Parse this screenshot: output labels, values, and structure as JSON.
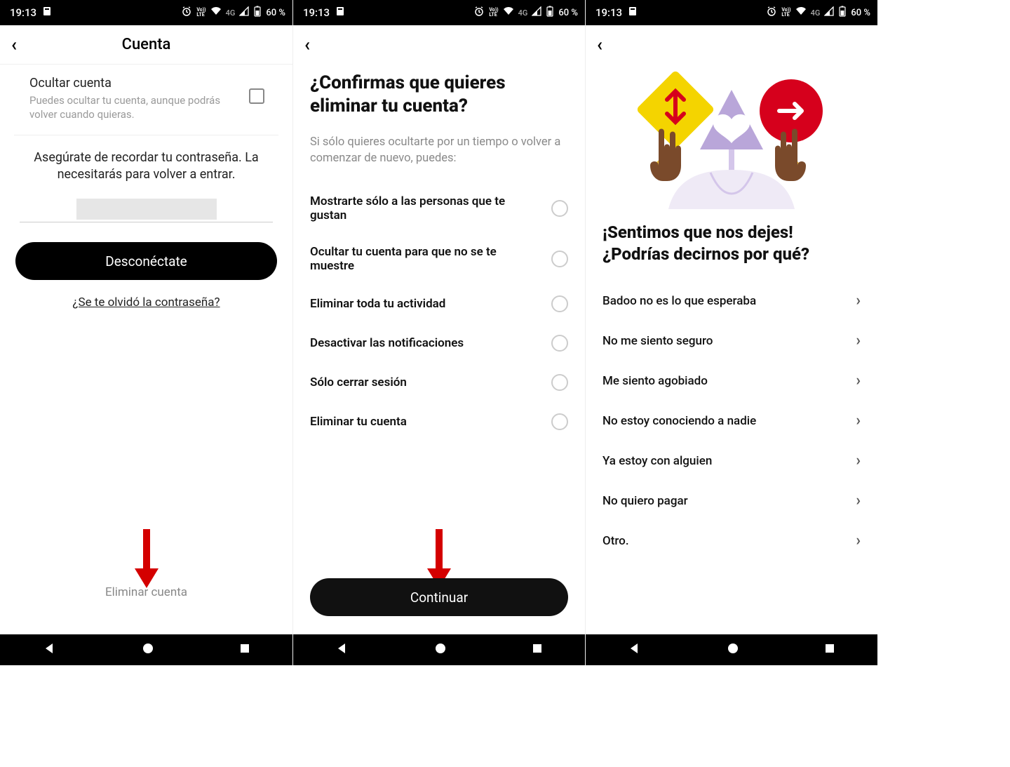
{
  "status": {
    "time": "19:13",
    "battery": "60 %",
    "net": "4G",
    "volte": "Vo))\nLTE"
  },
  "screen1": {
    "header_title": "Cuenta",
    "hide_title": "Ocultar cuenta",
    "hide_sub": "Puedes ocultar tu cuenta, aunque podrás volver cuando quieras.",
    "remember": "Asegúrate de recordar tu contraseña. La necesitarás para volver a entrar.",
    "disconnect": "Desconéctate",
    "forgot": "¿Se te olvidó la contraseña?",
    "delete": "Eliminar cuenta"
  },
  "screen2": {
    "title": "¿Confirmas que quieres eliminar tu cuenta?",
    "sub": "Si sólo quieres ocultarte por un tiempo o volver a comenzar de nuevo, puedes:",
    "options": [
      "Mostrarte sólo a las personas que te gustan",
      "Ocultar tu cuenta para que no se te muestre",
      "Eliminar toda tu actividad",
      "Desactivar las notificaciones",
      "Sólo cerrar sesión",
      "Eliminar tu cuenta"
    ],
    "continue": "Continuar"
  },
  "screen3": {
    "title_line1": "¡Sentimos que nos dejes!",
    "title_line2": "¿Podrías decirnos por qué?",
    "reasons": [
      "Badoo no es lo que esperaba",
      "No me siento seguro",
      "Me siento agobiado",
      "No estoy conociendo a nadie",
      "Ya estoy con alguien",
      "No quiero pagar",
      "Otro."
    ]
  }
}
